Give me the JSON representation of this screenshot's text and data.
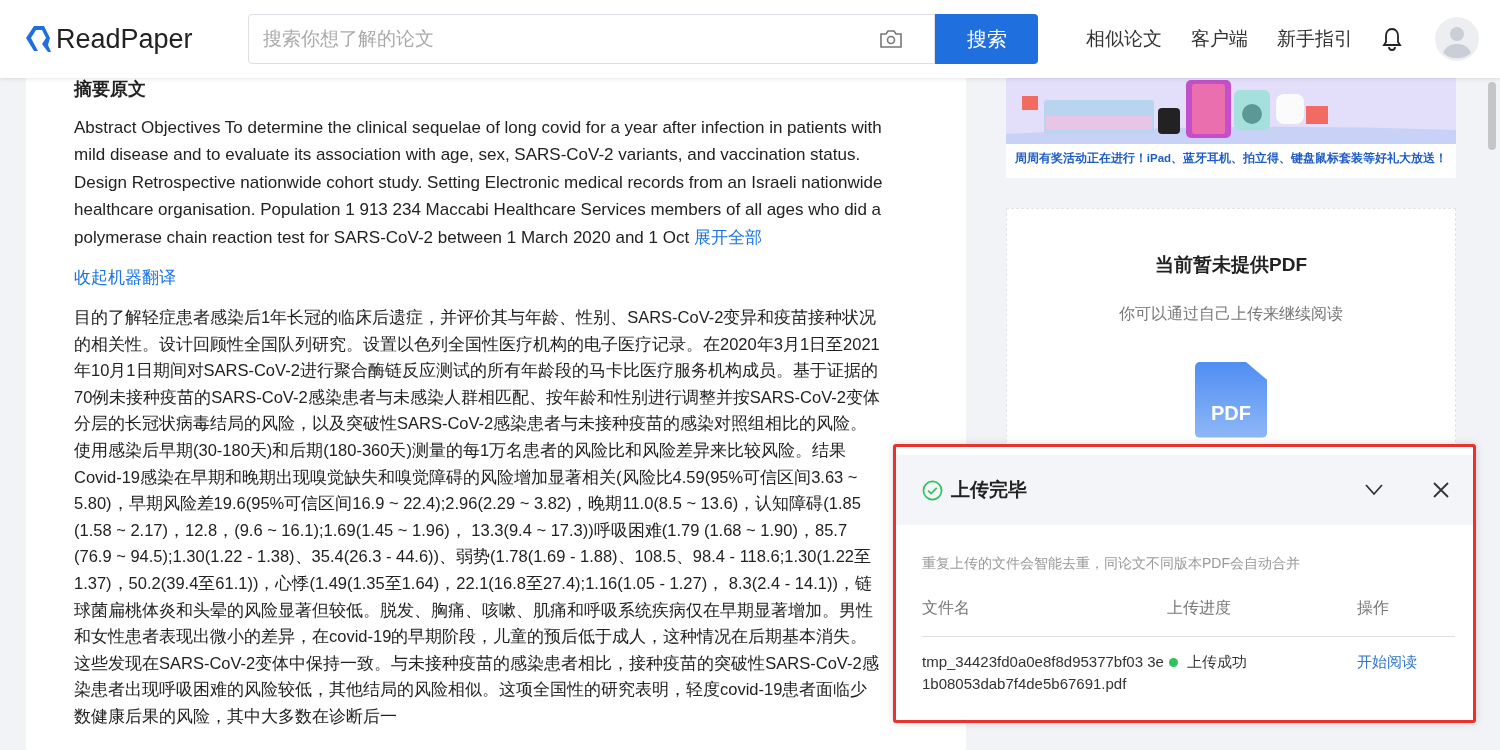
{
  "header": {
    "logo": "ReadPaper",
    "search": {
      "placeholder": "搜索你想了解的论文"
    },
    "search_button": "搜索",
    "nav": [
      "相似论文",
      "客户端",
      "新手指引"
    ]
  },
  "main": {
    "heading": "摘要原文",
    "abstract": "Abstract Objectives To determine the clinical sequelae of long covid for a year after infection in patients with mild disease and to evaluate its association with age, sex, SARS-CoV-2 variants, and vaccination status. Design Retrospective nationwide cohort study. Setting Electronic medical records from an Israeli nationwide healthcare organisation. Population 1 913 234 Maccabi Healthcare Services members of all ages who did a polymerase chain reaction test for SARS-CoV-2 between 1 March 2020 and 1 Oct",
    "expand_link": "展开全部",
    "collapse_link": "收起机器翻译",
    "translation": "目的了解轻症患者感染后1年长冠的临床后遗症，并评价其与年龄、性别、SARS-CoV-2变异和疫苗接种状况的相关性。设计回顾性全国队列研究。设置以色列全国性医疗机构的电子医疗记录。在2020年3月1日至2021年10月1日期间对SARS-CoV-2进行聚合酶链反应测试的所有年龄段的马卡比医疗服务机构成员。基于证据的70例未接种疫苗的SARS-CoV-2感染患者与未感染人群相匹配、按年龄和性别进行调整并按SARS-CoV-2变体分层的长冠状病毒结局的风险，以及突破性SARS-CoV-2感染患者与未接种疫苗的感染对照组相比的风险。使用感染后早期(30-180天)和后期(180-360天)测量的每1万名患者的风险比和风险差异来比较风险。结果Covid-19感染在早期和晚期出现嗅觉缺失和嗅觉障碍的风险增加显著相关(风险比4.59(95%可信区间3.63 ~ 5.80)，早期风险差19.6(95%可信区间16.9 ~ 22.4);2.96(2.29 ~ 3.82)，晚期11.0(8.5 ~ 13.6)，认知障碍(1.85 (1.58 ~ 2.17)，12.8，(9.6 ~ 16.1);1.69(1.45 ~ 1.96)， 13.3(9.4 ~ 17.3))呼吸困难(1.79 (1.68 ~ 1.90)，85.7 (76.9 ~ 94.5);1.30(1.22 - 1.38)、35.4(26.3 - 44.6))、弱势(1.78(1.69 - 1.88)、108.5、98.4 - 118.6;1.30(1.22至1.37)，50.2(39.4至61.1))，心悸(1.49(1.35至1.64)，22.1(16.8至27.4);1.16(1.05 - 1.27)， 8.3(2.4 - 14.1))，链球菌扁桃体炎和头晕的风险显著但较低。脱发、胸痛、咳嗽、肌痛和呼吸系统疾病仅在早期显著增加。男性和女性患者表现出微小的差异，在covid-19的早期阶段，儿童的预后低于成人，这种情况在后期基本消失。这些发现在SARS-CoV-2变体中保持一致。与未接种疫苗的感染患者相比，接种疫苗的突破性SARS-CoV-2感染患者出现呼吸困难的风险较低，其他结局的风险相似。这项全国性的研究表明，轻度covid-19患者面临少数健康后果的风险，其中大多数在诊断后一"
  },
  "side": {
    "banner": {
      "kind": "picture",
      "caption": "周周有奖活动正在进行！iPad、蓝牙耳机、拍立得、键盘鼠标套装等好礼大放送！"
    },
    "pdf_card": {
      "title": "当前暂未提供PDF",
      "subtitle": "你可以通过自己上传来继续阅读",
      "icon_label": "PDF"
    }
  },
  "upload_panel": {
    "title": "上传完毕",
    "notice": "重复上传的文件会智能去重，同论文不同版本PDF会自动合并",
    "columns": [
      "文件名",
      "上传进度",
      "操作"
    ],
    "rows": [
      {
        "file": "tmp_34423fd0a0e8f8d95377bf03 3e1b08053dab7f4de5b67691.pdf",
        "status": "上传成功",
        "action": "开始阅读"
      }
    ]
  }
}
